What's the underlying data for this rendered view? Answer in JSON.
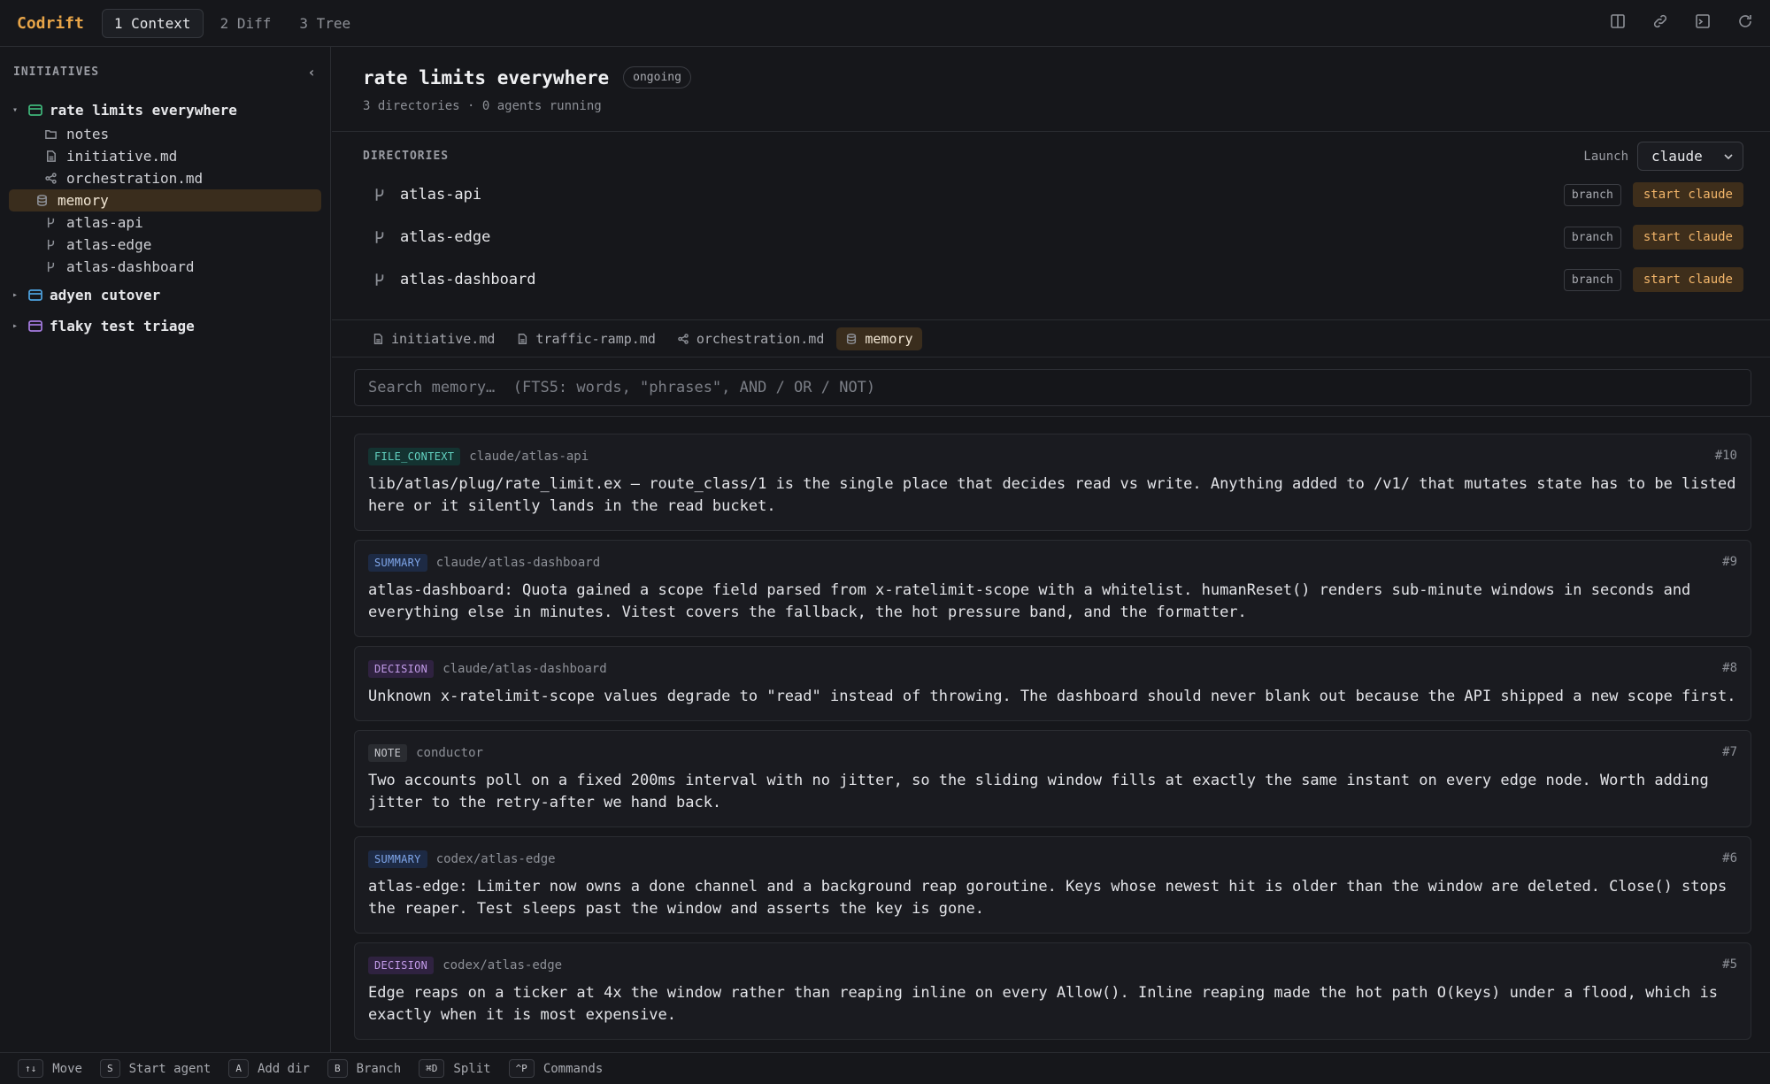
{
  "app": {
    "name": "Codrift"
  },
  "tabs": [
    {
      "label": "1 Context",
      "active": true
    },
    {
      "label": "2 Diff",
      "active": false
    },
    {
      "label": "3 Tree",
      "active": false
    }
  ],
  "top_icons": [
    "split-panel-icon",
    "link-icon",
    "terminal-icon",
    "refresh-icon"
  ],
  "sidebar": {
    "header": "INITIATIVES",
    "initiatives": [
      {
        "name": "rate limits everywhere",
        "expanded": true,
        "color": "#3fb67a",
        "children": [
          {
            "label": "notes",
            "icon": "folder-icon"
          },
          {
            "label": "initiative.md",
            "icon": "file-icon"
          },
          {
            "label": "orchestration.md",
            "icon": "share-icon"
          },
          {
            "label": "memory",
            "icon": "database-icon",
            "selected": true
          },
          {
            "label": "atlas-api",
            "icon": "branch-icon"
          },
          {
            "label": "atlas-edge",
            "icon": "branch-icon"
          },
          {
            "label": "atlas-dashboard",
            "icon": "branch-icon"
          }
        ]
      },
      {
        "name": "adyen cutover",
        "expanded": false,
        "color": "#4ea3e0"
      },
      {
        "name": "flaky test triage",
        "expanded": false,
        "color": "#a57be0"
      }
    ]
  },
  "header": {
    "title": "rate limits everywhere",
    "status": "ongoing",
    "subtitle": "3 directories · 0 agents running"
  },
  "directories": {
    "title": "DIRECTORIES",
    "launch_label": "Launch",
    "launch_value": "claude",
    "items": [
      {
        "name": "atlas-api",
        "branch_label": "branch",
        "start_label": "start claude"
      },
      {
        "name": "atlas-edge",
        "branch_label": "branch",
        "start_label": "start claude"
      },
      {
        "name": "atlas-dashboard",
        "branch_label": "branch",
        "start_label": "start claude"
      }
    ]
  },
  "file_tabs": [
    {
      "label": "initiative.md",
      "icon": "file-icon"
    },
    {
      "label": "traffic-ramp.md",
      "icon": "file-icon"
    },
    {
      "label": "orchestration.md",
      "icon": "share-icon"
    },
    {
      "label": "memory",
      "icon": "database-icon",
      "active": true
    }
  ],
  "search": {
    "placeholder": "Search memory…  (FTS5: words, \"phrases\", AND / OR / NOT)"
  },
  "memory": [
    {
      "tag": "FILE_CONTEXT",
      "tag_kind": "fc",
      "source": "claude/atlas-api",
      "num": "#10",
      "text": "lib/atlas/plug/rate_limit.ex — route_class/1 is the single place that decides read vs write. Anything added to /v1/ that mutates state has to be listed here or it silently lands in the read bucket."
    },
    {
      "tag": "SUMMARY",
      "tag_kind": "su",
      "source": "claude/atlas-dashboard",
      "num": "#9",
      "text": "atlas-dashboard: Quota gained a scope field parsed from x-ratelimit-scope with a whitelist. humanReset() renders sub-minute windows in seconds and everything else in minutes. Vitest covers the fallback, the hot pressure band, and the formatter."
    },
    {
      "tag": "DECISION",
      "tag_kind": "de",
      "source": "claude/atlas-dashboard",
      "num": "#8",
      "text": "Unknown x-ratelimit-scope values degrade to \"read\" instead of throwing. The dashboard should never blank out because the API shipped a new scope first."
    },
    {
      "tag": "NOTE",
      "tag_kind": "no",
      "source": "conductor",
      "num": "#7",
      "text": "Two accounts poll on a fixed 200ms interval with no jitter, so the sliding window fills at exactly the same instant on every edge node. Worth adding jitter to the retry-after we hand back."
    },
    {
      "tag": "SUMMARY",
      "tag_kind": "su",
      "source": "codex/atlas-edge",
      "num": "#6",
      "text": "atlas-edge: Limiter now owns a done channel and a background reap goroutine. Keys whose newest hit is older than the window are deleted. Close() stops the reaper. Test sleeps past the window and asserts the key is gone."
    },
    {
      "tag": "DECISION",
      "tag_kind": "de",
      "source": "codex/atlas-edge",
      "num": "#5",
      "text": "Edge reaps on a ticker at 4x the window rather than reaping inline on every Allow(). Inline reaping made the hot path O(keys) under a flood, which is exactly when it is most expensive."
    }
  ],
  "shortcuts": [
    {
      "key": "↑↓",
      "label": "Move"
    },
    {
      "key": "S",
      "label": "Start agent"
    },
    {
      "key": "A",
      "label": "Add dir"
    },
    {
      "key": "B",
      "label": "Branch"
    },
    {
      "key": "⌘D",
      "label": "Split"
    },
    {
      "key": "^P",
      "label": "Commands"
    }
  ]
}
